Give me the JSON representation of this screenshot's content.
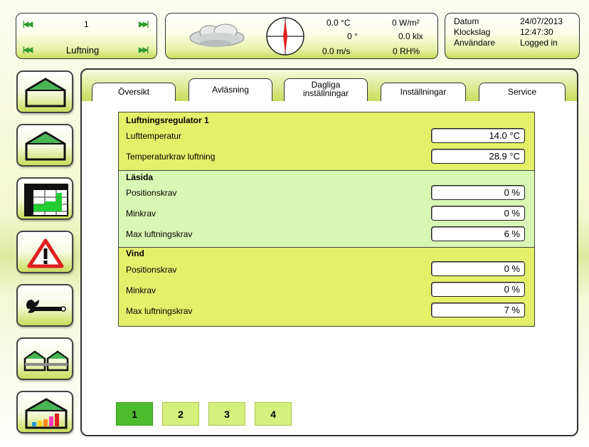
{
  "header": {
    "nav": {
      "top_value": "1",
      "bottom_label": "Luftning"
    },
    "weather": {
      "temperature": "0.0 °C",
      "radiation": "0 W/m²",
      "direction": "0 °",
      "light": "0.0 klx",
      "wind_speed": "0.0 m/s",
      "humidity": "0 RH%"
    },
    "info": {
      "date_label": "Datum",
      "date_value": "24/07/2013",
      "time_label": "Klockslag",
      "time_value": "12:47:30",
      "user_label": "Användare",
      "user_value": "Logged in"
    }
  },
  "tabs": [
    {
      "label": "Översikt"
    },
    {
      "label": "Avläsning"
    },
    {
      "label_line1": "Dagliga",
      "label_line2": "inställningar"
    },
    {
      "label": "Inställningar"
    },
    {
      "label": "Service"
    }
  ],
  "sections": [
    {
      "title": "Luftningsregulator 1",
      "rows": [
        {
          "label": "Lufttemperatur",
          "value": "14.0 °C"
        },
        {
          "label": "Temperaturkrav luftning",
          "value": "28.9 °C"
        }
      ]
    },
    {
      "title": "Läsida",
      "rows": [
        {
          "label": "Positionskrav",
          "value": "0 %"
        },
        {
          "label": "Minkrav",
          "value": "0 %"
        },
        {
          "label": "Max luftningskrav",
          "value": "6 %"
        }
      ]
    },
    {
      "title": "Vind",
      "rows": [
        {
          "label": "Positionskrav",
          "value": "0 %"
        },
        {
          "label": "Minkrav",
          "value": "0 %"
        },
        {
          "label": "Max luftningskrav",
          "value": "7 %"
        }
      ]
    }
  ],
  "pages": [
    {
      "label": "1",
      "active": true
    },
    {
      "label": "2"
    },
    {
      "label": "3"
    },
    {
      "label": "4"
    }
  ],
  "colors": {
    "accent_green": "#c9dc5a",
    "section_yellow": "#e3f06a",
    "section_light_green": "#d9f7b4",
    "page_active": "#4cbc2c",
    "page_inactive": "#d6f07e",
    "alarm_red": "#e02020"
  },
  "sidebar": [
    {
      "icon": "greenhouse-icon"
    },
    {
      "icon": "greenhouse-icon"
    },
    {
      "icon": "chart-grid-icon"
    },
    {
      "icon": "warning-icon"
    },
    {
      "icon": "wrench-icon"
    },
    {
      "icon": "greenhouse-connection-icon"
    },
    {
      "icon": "greenhouse-chart-icon"
    }
  ]
}
